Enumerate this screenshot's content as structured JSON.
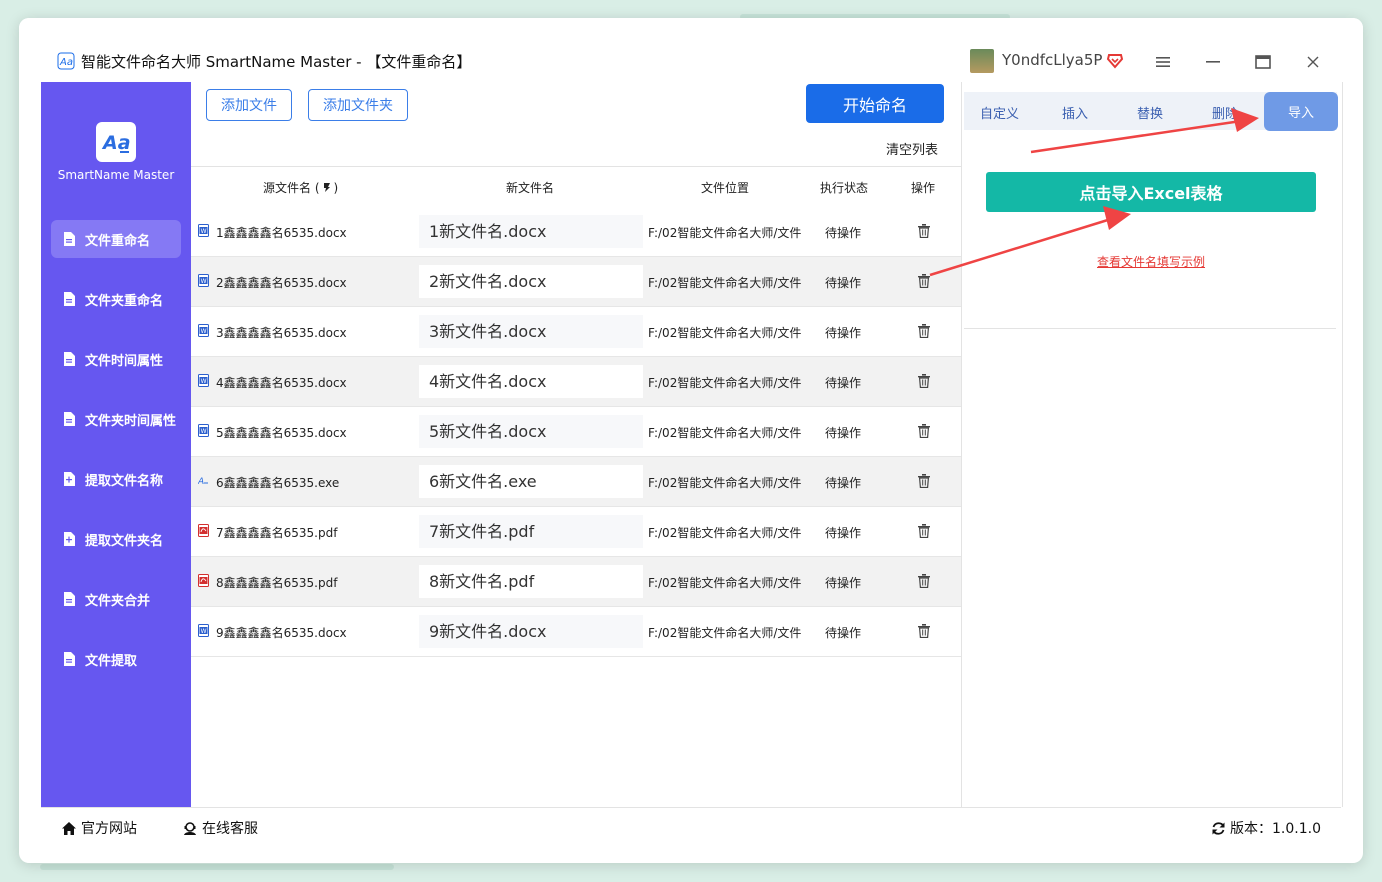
{
  "window": {
    "title": "智能文件命名大师 SmartName Master - 【文件重命名】",
    "username": "Y0ndfcLlya5P"
  },
  "sidebar": {
    "logo_text": "SmartName Master",
    "items": [
      {
        "label": "文件重命名",
        "active": true
      },
      {
        "label": "文件夹重命名"
      },
      {
        "label": "文件时间属性"
      },
      {
        "label": "文件夹时间属性"
      },
      {
        "label": "提取文件名称"
      },
      {
        "label": "提取文件夹名"
      },
      {
        "label": "文件夹合并"
      },
      {
        "label": "文件提取"
      }
    ]
  },
  "toolbar": {
    "add_file": "添加文件",
    "add_folder": "添加文件夹",
    "start": "开始命名",
    "clear": "清空列表"
  },
  "table": {
    "headers": {
      "source": "源文件名 (",
      "source_suffix": ")",
      "new_name": "新文件名",
      "location": "文件位置",
      "status": "执行状态",
      "action": "操作"
    },
    "rows": [
      {
        "type": "docx",
        "source": "1鑫鑫鑫鑫名6535.docx",
        "new_name": "1新文件名.docx",
        "location": "F:/02智能文件命名大师/文件",
        "status": "待操作"
      },
      {
        "type": "docx",
        "source": "2鑫鑫鑫鑫名6535.docx",
        "new_name": "2新文件名.docx",
        "location": "F:/02智能文件命名大师/文件",
        "status": "待操作"
      },
      {
        "type": "docx",
        "source": "3鑫鑫鑫鑫名6535.docx",
        "new_name": "3新文件名.docx",
        "location": "F:/02智能文件命名大师/文件",
        "status": "待操作"
      },
      {
        "type": "docx",
        "source": "4鑫鑫鑫鑫名6535.docx",
        "new_name": "4新文件名.docx",
        "location": "F:/02智能文件命名大师/文件",
        "status": "待操作"
      },
      {
        "type": "docx",
        "source": "5鑫鑫鑫鑫名6535.docx",
        "new_name": "5新文件名.docx",
        "location": "F:/02智能文件命名大师/文件",
        "status": "待操作"
      },
      {
        "type": "exe",
        "source": "6鑫鑫鑫鑫名6535.exe",
        "new_name": "6新文件名.exe",
        "location": "F:/02智能文件命名大师/文件",
        "status": "待操作"
      },
      {
        "type": "pdf",
        "source": "7鑫鑫鑫鑫名6535.pdf",
        "new_name": "7新文件名.pdf",
        "location": "F:/02智能文件命名大师/文件",
        "status": "待操作"
      },
      {
        "type": "pdf",
        "source": "8鑫鑫鑫鑫名6535.pdf",
        "new_name": "8新文件名.pdf",
        "location": "F:/02智能文件命名大师/文件",
        "status": "待操作"
      },
      {
        "type": "docx",
        "source": "9鑫鑫鑫鑫名6535.docx",
        "new_name": "9新文件名.docx",
        "location": "F:/02智能文件命名大师/文件",
        "status": "待操作"
      }
    ]
  },
  "right_panel": {
    "tabs": [
      "自定义",
      "插入",
      "替换",
      "删除"
    ],
    "active_tab": "导入",
    "import_button": "点击导入Excel表格",
    "example_link": "查看文件名填写示例"
  },
  "footer": {
    "website": "官方网站",
    "support": "在线客服",
    "version": "版本：1.0.1.0"
  },
  "colors": {
    "sidebar": "#6657f0",
    "primary": "#1a6ce8",
    "teal": "#14b8a6",
    "arrow": "#ef4444"
  }
}
